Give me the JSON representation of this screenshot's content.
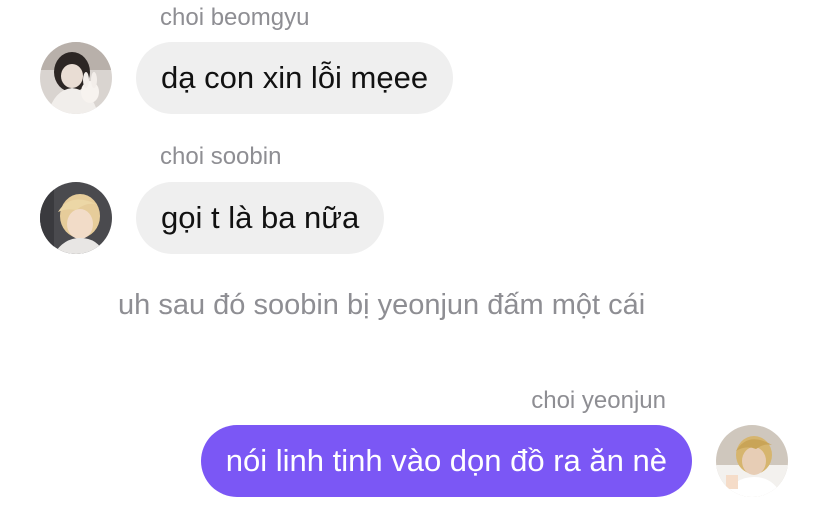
{
  "messages": [
    {
      "sender": "choi beomgyu",
      "text": "dạ con xin lỗi mẹee",
      "avatar_icon": "user-avatar-beomgyu"
    },
    {
      "sender": "choi soobin",
      "text": "gọi t là ba nữa",
      "avatar_icon": "user-avatar-soobin"
    },
    {
      "system_text": "uh sau đó soobin bị yeonjun đấm một cái"
    },
    {
      "sender": "choi yeonjun",
      "text": "nói linh tinh vào dọn đồ ra ăn nè",
      "avatar_icon": "user-avatar-yeonjun"
    }
  ],
  "colors": {
    "incoming_bubble": "#efefef",
    "outgoing_bubble": "#7b57f5",
    "sender_name": "#8e8e93",
    "system_text": "#8e8e93"
  }
}
